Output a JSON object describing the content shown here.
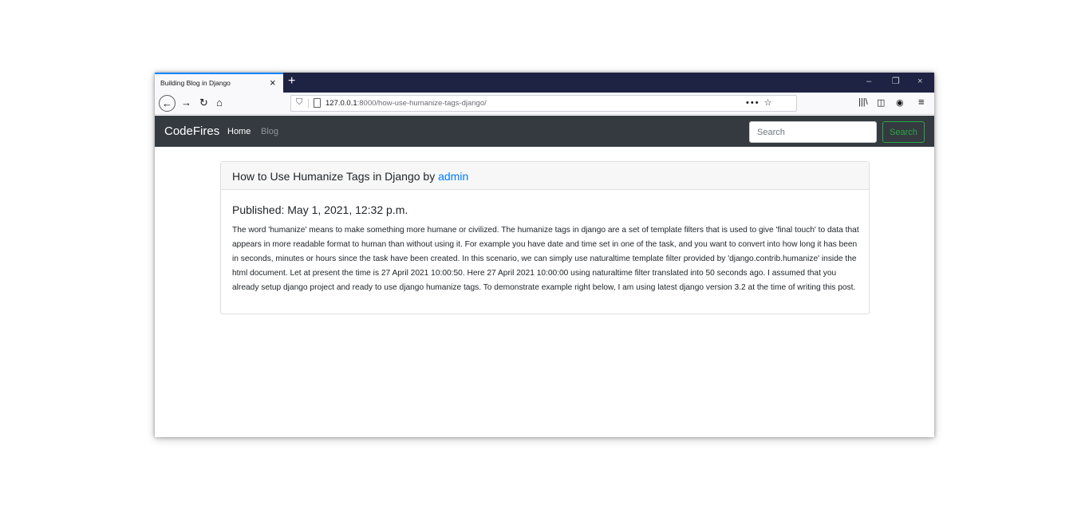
{
  "browser": {
    "tab_title": "Building Blog in Django",
    "tab_close": "×",
    "new_tab": "+",
    "window_controls": {
      "minimize": "–",
      "maximize": "❐",
      "close": "×"
    },
    "url_host": "127.0.0.1",
    "url_rest": ":8000/how-use-humanize-tags-django/",
    "icons": {
      "back": "←",
      "forward": "→",
      "reload": "↻",
      "home": "⌂",
      "shield": "⛉",
      "page_actions": "••• ☆",
      "library": "|||\\",
      "sidebar": "◫",
      "account": "◉",
      "menu": "≡"
    }
  },
  "site": {
    "brand": "CodeFires",
    "nav_home": "Home",
    "nav_blog": "Blog",
    "search_placeholder": "Search",
    "search_button": "Search"
  },
  "post": {
    "title_prefix": "How to Use Humanize Tags in Django by ",
    "author": "admin",
    "published": "Published: May 1, 2021, 12:32 p.m.",
    "body": "The word 'humanize' means to make something more humane or civilized. The humanize tags in django are a set of template filters that is used to give 'final touch' to data that appears in more readable format to human than without using it. For example you have date and time set in one of the task, and you want to convert into how long it has been in seconds, minutes or hours since the task have been created. In this scenario, we can simply use naturaltime template filter provided by 'django.contrib.humanize' inside the html document. Let at present the time is 27 April 2021 10:00:50. Here 27 April 2021 10:00:00 using naturaltime filter translated into 50 seconds ago. I assumed that you already setup django project and ready to use django humanize tags. To demonstrate example right below, I am using latest django version 3.2 at the time of writing this post."
  },
  "colors": {
    "navbar_bg": "#343a40",
    "link_blue": "#007bff",
    "success_green": "#28a745",
    "tabbar_bg": "#1f2343"
  }
}
